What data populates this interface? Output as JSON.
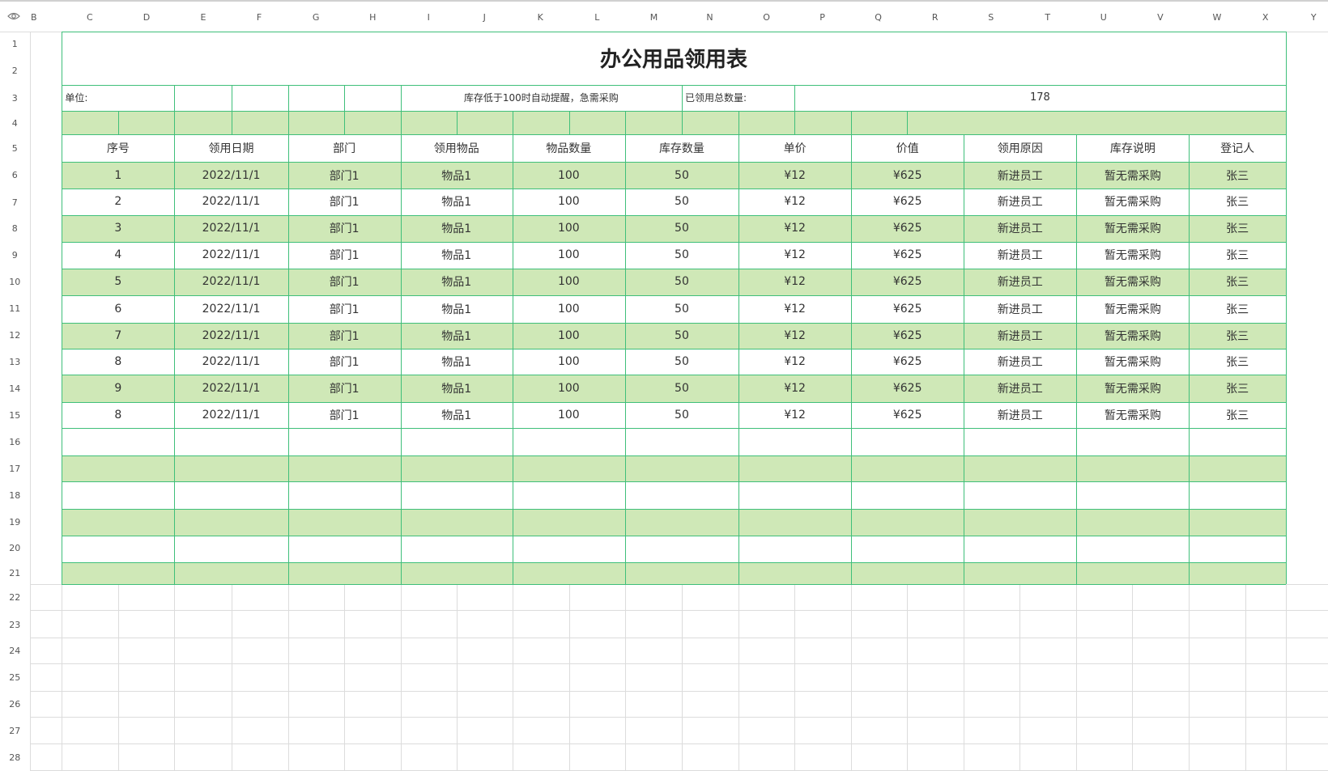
{
  "column_headers": [
    "B",
    "C",
    "D",
    "E",
    "F",
    "G",
    "H",
    "I",
    "J",
    "K",
    "L",
    "M",
    "N",
    "O",
    "P",
    "Q",
    "R",
    "S",
    "T",
    "U",
    "V",
    "W",
    "X",
    "Y"
  ],
  "row_numbers": [
    "1",
    "2",
    "3",
    "4",
    "5",
    "6",
    "7",
    "8",
    "9",
    "10",
    "11",
    "12",
    "13",
    "14",
    "15",
    "16",
    "17",
    "18",
    "19",
    "20",
    "21",
    "22",
    "23",
    "24",
    "25",
    "26",
    "27",
    "28"
  ],
  "title": "办公用品领用表",
  "info": {
    "unit_label": "单位:",
    "alert_text": "库存低于100时自动提醒，急需采购",
    "total_label": "已领用总数量:",
    "total_value": "178"
  },
  "table": {
    "headers": [
      "序号",
      "领用日期",
      "部门",
      "领用物品",
      "物品数量",
      "库存数量",
      "单价",
      "价值",
      "领用原因",
      "库存说明",
      "登记人"
    ],
    "rows": [
      [
        "1",
        "2022/11/1",
        "部门1",
        "物品1",
        "100",
        "50",
        "¥12",
        "¥625",
        "新进员工",
        "暂无需采购",
        "张三"
      ],
      [
        "2",
        "2022/11/1",
        "部门1",
        "物品1",
        "100",
        "50",
        "¥12",
        "¥625",
        "新进员工",
        "暂无需采购",
        "张三"
      ],
      [
        "3",
        "2022/11/1",
        "部门1",
        "物品1",
        "100",
        "50",
        "¥12",
        "¥625",
        "新进员工",
        "暂无需采购",
        "张三"
      ],
      [
        "4",
        "2022/11/1",
        "部门1",
        "物品1",
        "100",
        "50",
        "¥12",
        "¥625",
        "新进员工",
        "暂无需采购",
        "张三"
      ],
      [
        "5",
        "2022/11/1",
        "部门1",
        "物品1",
        "100",
        "50",
        "¥12",
        "¥625",
        "新进员工",
        "暂无需采购",
        "张三"
      ],
      [
        "6",
        "2022/11/1",
        "部门1",
        "物品1",
        "100",
        "50",
        "¥12",
        "¥625",
        "新进员工",
        "暂无需采购",
        "张三"
      ],
      [
        "7",
        "2022/11/1",
        "部门1",
        "物品1",
        "100",
        "50",
        "¥12",
        "¥625",
        "新进员工",
        "暂无需采购",
        "张三"
      ],
      [
        "8",
        "2022/11/1",
        "部门1",
        "物品1",
        "100",
        "50",
        "¥12",
        "¥625",
        "新进员工",
        "暂无需采购",
        "张三"
      ],
      [
        "9",
        "2022/11/1",
        "部门1",
        "物品1",
        "100",
        "50",
        "¥12",
        "¥625",
        "新进员工",
        "暂无需采购",
        "张三"
      ],
      [
        "8",
        "2022/11/1",
        "部门1",
        "物品1",
        "100",
        "50",
        "¥12",
        "¥625",
        "新进员工",
        "暂无需采购",
        "张三"
      ]
    ]
  },
  "colors": {
    "band": "#cfe8b7",
    "border": "#3fbf7a",
    "grid": "#dcdcdc"
  },
  "icons": {
    "corner": "eye-icon"
  }
}
